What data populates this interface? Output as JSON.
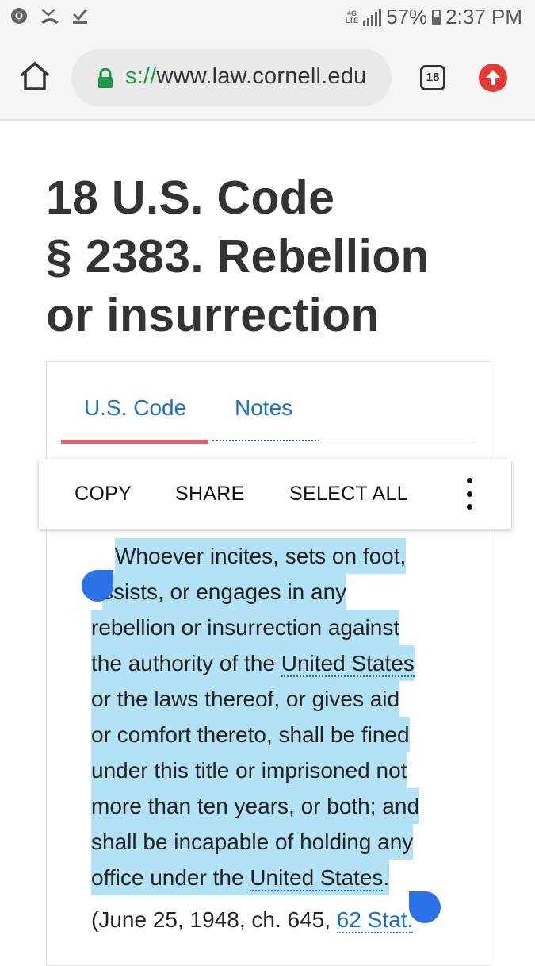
{
  "status_bar": {
    "battery": "57%",
    "time": "2:37 PM",
    "network": "4G",
    "icons": [
      "chrome-icon",
      "missed-call-icon",
      "download-done-icon",
      "signal-icon",
      "battery-icon"
    ]
  },
  "browser": {
    "url_scheme": "s://",
    "url_host": "www.law.cornell.edu",
    "tab_count": "18",
    "colors": {
      "lock": "#1e9a4b",
      "update": "#e53935"
    }
  },
  "page": {
    "title_line1": "18 U.S. Code",
    "title_line2": "§ 2383. Rebellion",
    "title_line3": "or insurrection",
    "tabs": [
      {
        "label": "U.S. Code",
        "active": true
      },
      {
        "label": "Notes",
        "active": false
      }
    ],
    "context_menu": {
      "copy": "COPY",
      "share": "SHARE",
      "select_all": "SELECT ALL"
    },
    "body": {
      "l1": "Whoever incites, sets on foot,",
      "l2": "ssists, or engages in any",
      "l3": "rebellion or insurrection against",
      "l4a": "the authority of the ",
      "l4_link": "United States",
      "l5": "or the laws thereof, or gives aid",
      "l6": "or comfort thereto, shall be fined",
      "l7": "under this title or imprisoned not",
      "l8": "more than ten years, or both; and",
      "l9": "shall be incapable of holding any",
      "l10a": "office under the ",
      "l10_link": "United States",
      "l10b": ".",
      "note_a": "(June 25, 1948, ch. 645, ",
      "note_link": "62 Stat."
    },
    "colors": {
      "selection": "#b3e2f6",
      "link": "#1d6fbf",
      "active_tab_underline": "#e35d6a",
      "handle": "#2a72e5"
    }
  }
}
